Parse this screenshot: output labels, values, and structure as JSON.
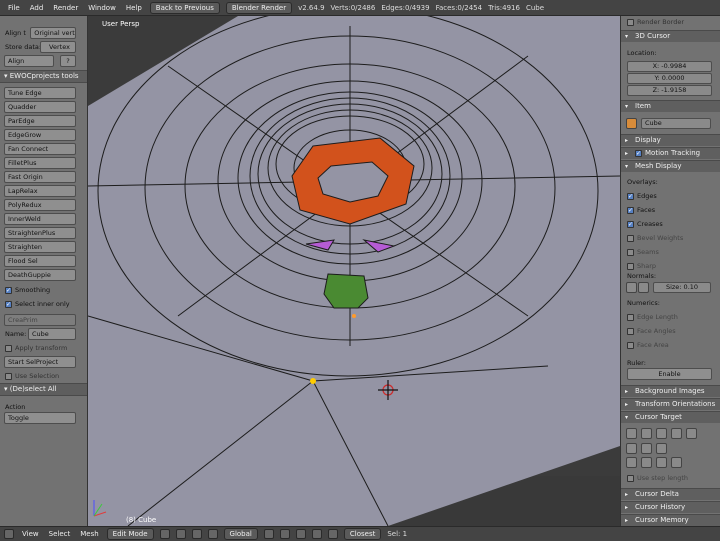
{
  "topbar": {
    "menus": [
      "File",
      "Add",
      "Render",
      "Window",
      "Help"
    ],
    "back_button": "Back to Previous",
    "render_engine": "Blender Render",
    "version": "v2.64.9",
    "verts": "Verts:0/2486",
    "edges": "Edges:0/4939",
    "faces": "Faces:0/2454",
    "tris": "Tris:4916",
    "object": "Cube"
  },
  "toolshelf": {
    "align_label": "Align t",
    "align_value": "Original vert",
    "store_label": "Store data:",
    "store_value": "Vertex",
    "align_button": "Align",
    "help_button": "?",
    "section_title": "EWOCprojects tools",
    "tools": [
      "Tune Edge",
      "Quadder",
      "ParEdge",
      "EdgeGrow",
      "Fan Connect",
      "FilletPlus",
      "Fast Origin",
      "LapRelax",
      "PolyRedux",
      "InnerWeld",
      "StraightenPlus",
      "Straighten",
      "Flood Sel",
      "DeathGuppie"
    ],
    "smoothing": "Smoothing",
    "select_inner_only": "Select inner only",
    "creaprim": "CreaPrim",
    "name_label": "Name:",
    "name_value": "Cube",
    "apply_transform": "Apply transform",
    "start_selproject": "Start SelProject",
    "use_selection": "Use Selection",
    "deselect_all": "(De)select All",
    "action_label": "Action",
    "action_value": "Toggle"
  },
  "viewport": {
    "view_name": "User Persp",
    "object_label": "(8) Cube"
  },
  "properties": {
    "render_border": "Render Border",
    "cursor_title": "3D Cursor",
    "location_label": "Location:",
    "x": "X: -0.9984",
    "y": "Y: 0.0000",
    "z": "Z: -1.9158",
    "item_title": "Item",
    "item_name": "Cube",
    "display_title": "Display",
    "motion_tracking": "Motion Tracking",
    "mesh_display_title": "Mesh Display",
    "overlays_label": "Overlays:",
    "overlays": [
      {
        "label": "Edges",
        "checked": true
      },
      {
        "label": "Faces",
        "checked": true
      },
      {
        "label": "Creases",
        "checked": true
      },
      {
        "label": "Bevel Weights",
        "checked": false
      },
      {
        "label": "Seams",
        "checked": false
      },
      {
        "label": "Sharp",
        "checked": false
      }
    ],
    "normals_label": "Normals:",
    "normals_size": "Size: 0.10",
    "numerics_label": "Numerics:",
    "numerics": [
      "Edge Length",
      "Face Angles",
      "Face Area"
    ],
    "ruler_label": "Ruler:",
    "enable_button": "Enable",
    "background_images": "Background Images",
    "transform_orientations": "Transform Orientations",
    "cursor_target": "Cursor Target",
    "use_step_length": "Use step length",
    "cursor_delta": "Cursor Delta",
    "cursor_history": "Cursor History",
    "cursor_memory": "Cursor Memory"
  },
  "bottombar": {
    "view": "View",
    "select": "Select",
    "mesh": "Mesh",
    "mode": "Edit Mode",
    "orientation": "Global",
    "snap": "Closest",
    "layer": "Sel: 1"
  },
  "colors": {
    "orange_faces": "#d2521c",
    "green_face": "#4a8a32",
    "purple_faces": "#b55cd4",
    "mesh_fill": "#9494a4"
  }
}
